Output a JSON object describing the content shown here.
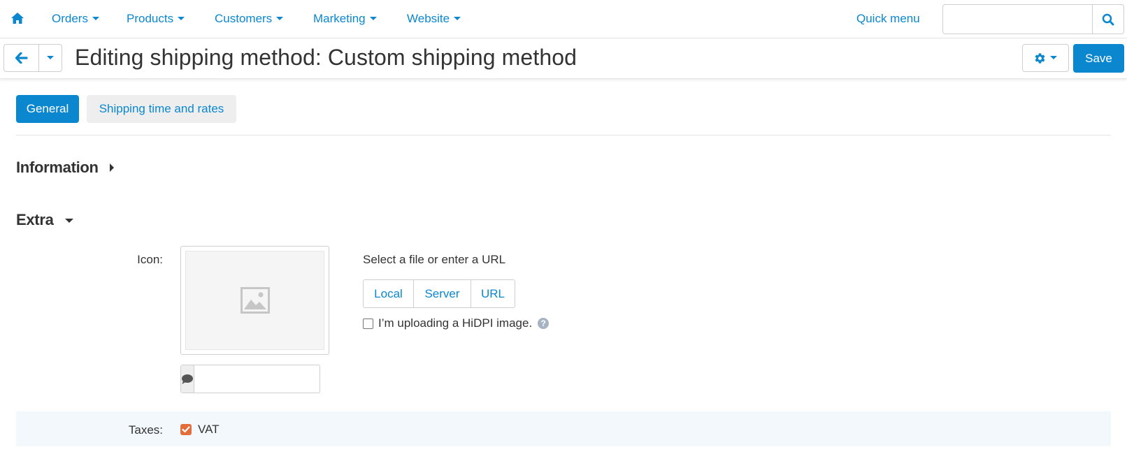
{
  "nav": {
    "items": [
      {
        "label": "Orders"
      },
      {
        "label": "Products"
      },
      {
        "label": "Customers"
      },
      {
        "label": "Marketing"
      },
      {
        "label": "Website"
      }
    ],
    "quick_menu": "Quick menu",
    "search": {
      "value": "",
      "placeholder": ""
    }
  },
  "header": {
    "title": "Editing shipping method: Custom shipping method",
    "save_label": "Save"
  },
  "tabs": [
    {
      "label": "General",
      "active": true
    },
    {
      "label": "Shipping time and rates",
      "active": false
    }
  ],
  "sections": {
    "information": {
      "title": "Information",
      "expanded": false
    },
    "extra": {
      "title": "Extra",
      "expanded": true
    }
  },
  "icon_field": {
    "label": "Icon:",
    "select_text": "Select a file or enter a URL",
    "sources": [
      "Local",
      "Server",
      "URL"
    ],
    "hidpi_label": "I’m uploading a HiDPI image.",
    "hidpi_checked": false,
    "alt_value": ""
  },
  "taxes": {
    "label": "Taxes:",
    "items": [
      {
        "label": "VAT",
        "checked": true
      }
    ]
  },
  "colors": {
    "accent": "#0b87cf",
    "checkbox_checked": "#e36d3b",
    "row_highlight": "#f2f8fc"
  },
  "icons": [
    "home-icon",
    "search-icon",
    "back-arrow-icon",
    "chevron-down-icon",
    "gear-icon",
    "image-placeholder-icon",
    "comment-icon",
    "help-icon",
    "checkmark-icon"
  ]
}
